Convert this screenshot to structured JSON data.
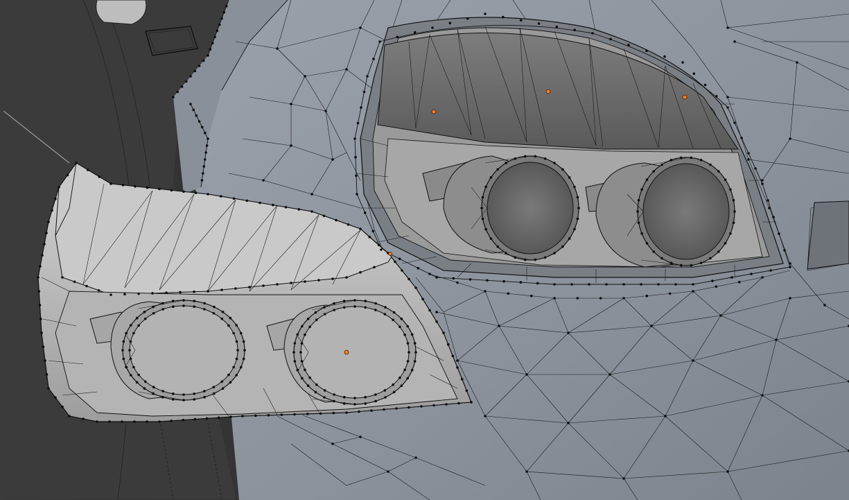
{
  "viewport": {
    "mode": "edit-mode-wireframe-overlay",
    "background_color": "#3a3a3a",
    "body_color": "#8e96a0",
    "headlight_housing_color": "#bdbdbd",
    "inner_lens_color": "#6e6e6e",
    "wire_color": "#111111",
    "vertex_color": "#0c0c0c",
    "object_origin_color": "#ff7a1a"
  }
}
